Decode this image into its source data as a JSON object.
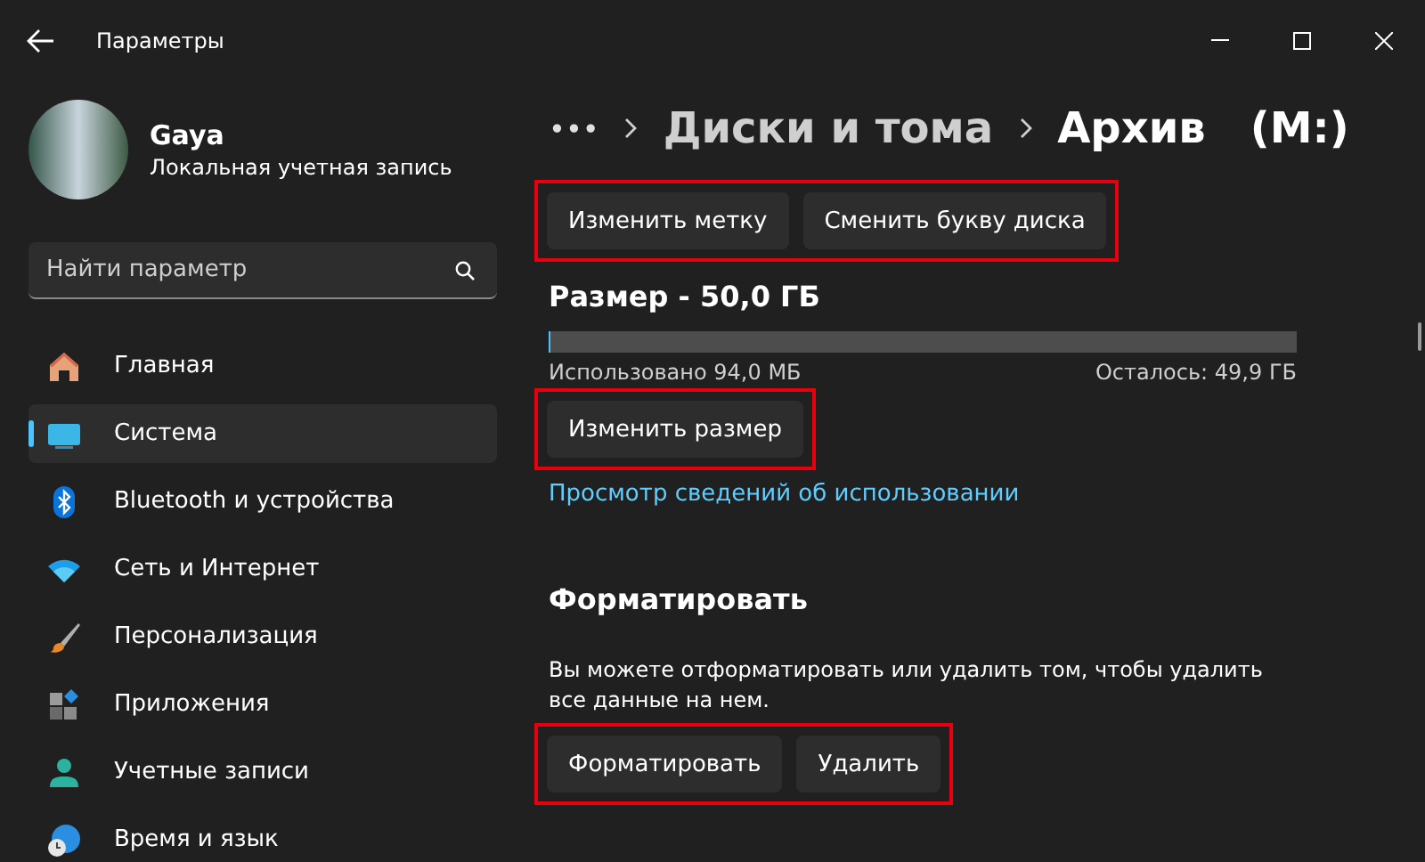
{
  "window": {
    "title": "Параметры"
  },
  "profile": {
    "name": "Gaya",
    "account_type": "Локальная учетная запись"
  },
  "search": {
    "placeholder": "Найти параметр"
  },
  "sidebar": {
    "items": [
      {
        "label": "Главная",
        "kind": "home",
        "selected": false
      },
      {
        "label": "Система",
        "kind": "system",
        "selected": true
      },
      {
        "label": "Bluetooth и устройства",
        "kind": "bluetooth",
        "selected": false
      },
      {
        "label": "Сеть и Интернет",
        "kind": "network",
        "selected": false
      },
      {
        "label": "Персонализация",
        "kind": "personalization",
        "selected": false
      },
      {
        "label": "Приложения",
        "kind": "apps",
        "selected": false
      },
      {
        "label": "Учетные записи",
        "kind": "accounts",
        "selected": false
      },
      {
        "label": "Время и язык",
        "kind": "time",
        "selected": false
      }
    ]
  },
  "breadcrumb": {
    "overflow": "•••",
    "items": [
      "Диски и тома",
      "Архив   (M:)"
    ]
  },
  "label_buttons": {
    "highlighted": true,
    "buttons": [
      "Изменить метку",
      "Сменить букву диска"
    ]
  },
  "size": {
    "title": "Размер - 50,0 ГБ",
    "level": 0.002,
    "used": "Использовано 94,0 МБ",
    "free": "Осталось: 49,9 ГБ",
    "resize": {
      "highlighted": true,
      "buttons": [
        "Изменить размер"
      ]
    },
    "link": "Просмотр сведений об использовании"
  },
  "format": {
    "title": "Форматировать",
    "description": "Вы можете отформатировать или удалить том, чтобы удалить все данные на нем.",
    "actions": {
      "highlighted": true,
      "buttons": [
        "Форматировать",
        "Удалить"
      ]
    }
  }
}
